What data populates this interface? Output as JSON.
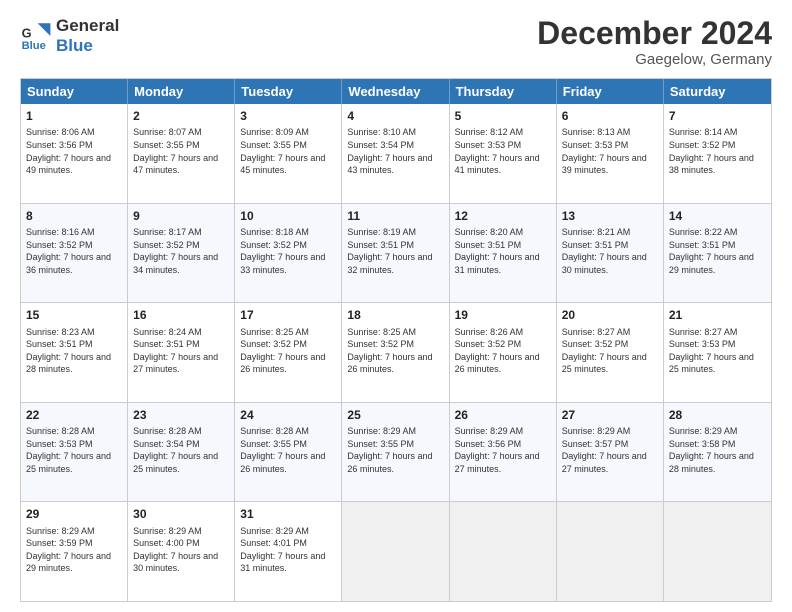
{
  "header": {
    "logo_line1": "General",
    "logo_line2": "Blue",
    "month_title": "December 2024",
    "location": "Gaegelow, Germany"
  },
  "weekdays": [
    "Sunday",
    "Monday",
    "Tuesday",
    "Wednesday",
    "Thursday",
    "Friday",
    "Saturday"
  ],
  "weeks": [
    [
      {
        "day": "1",
        "sunrise": "Sunrise: 8:06 AM",
        "sunset": "Sunset: 3:56 PM",
        "daylight": "Daylight: 7 hours and 49 minutes."
      },
      {
        "day": "2",
        "sunrise": "Sunrise: 8:07 AM",
        "sunset": "Sunset: 3:55 PM",
        "daylight": "Daylight: 7 hours and 47 minutes."
      },
      {
        "day": "3",
        "sunrise": "Sunrise: 8:09 AM",
        "sunset": "Sunset: 3:55 PM",
        "daylight": "Daylight: 7 hours and 45 minutes."
      },
      {
        "day": "4",
        "sunrise": "Sunrise: 8:10 AM",
        "sunset": "Sunset: 3:54 PM",
        "daylight": "Daylight: 7 hours and 43 minutes."
      },
      {
        "day": "5",
        "sunrise": "Sunrise: 8:12 AM",
        "sunset": "Sunset: 3:53 PM",
        "daylight": "Daylight: 7 hours and 41 minutes."
      },
      {
        "day": "6",
        "sunrise": "Sunrise: 8:13 AM",
        "sunset": "Sunset: 3:53 PM",
        "daylight": "Daylight: 7 hours and 39 minutes."
      },
      {
        "day": "7",
        "sunrise": "Sunrise: 8:14 AM",
        "sunset": "Sunset: 3:52 PM",
        "daylight": "Daylight: 7 hours and 38 minutes."
      }
    ],
    [
      {
        "day": "8",
        "sunrise": "Sunrise: 8:16 AM",
        "sunset": "Sunset: 3:52 PM",
        "daylight": "Daylight: 7 hours and 36 minutes."
      },
      {
        "day": "9",
        "sunrise": "Sunrise: 8:17 AM",
        "sunset": "Sunset: 3:52 PM",
        "daylight": "Daylight: 7 hours and 34 minutes."
      },
      {
        "day": "10",
        "sunrise": "Sunrise: 8:18 AM",
        "sunset": "Sunset: 3:52 PM",
        "daylight": "Daylight: 7 hours and 33 minutes."
      },
      {
        "day": "11",
        "sunrise": "Sunrise: 8:19 AM",
        "sunset": "Sunset: 3:51 PM",
        "daylight": "Daylight: 7 hours and 32 minutes."
      },
      {
        "day": "12",
        "sunrise": "Sunrise: 8:20 AM",
        "sunset": "Sunset: 3:51 PM",
        "daylight": "Daylight: 7 hours and 31 minutes."
      },
      {
        "day": "13",
        "sunrise": "Sunrise: 8:21 AM",
        "sunset": "Sunset: 3:51 PM",
        "daylight": "Daylight: 7 hours and 30 minutes."
      },
      {
        "day": "14",
        "sunrise": "Sunrise: 8:22 AM",
        "sunset": "Sunset: 3:51 PM",
        "daylight": "Daylight: 7 hours and 29 minutes."
      }
    ],
    [
      {
        "day": "15",
        "sunrise": "Sunrise: 8:23 AM",
        "sunset": "Sunset: 3:51 PM",
        "daylight": "Daylight: 7 hours and 28 minutes."
      },
      {
        "day": "16",
        "sunrise": "Sunrise: 8:24 AM",
        "sunset": "Sunset: 3:51 PM",
        "daylight": "Daylight: 7 hours and 27 minutes."
      },
      {
        "day": "17",
        "sunrise": "Sunrise: 8:25 AM",
        "sunset": "Sunset: 3:52 PM",
        "daylight": "Daylight: 7 hours and 26 minutes."
      },
      {
        "day": "18",
        "sunrise": "Sunrise: 8:25 AM",
        "sunset": "Sunset: 3:52 PM",
        "daylight": "Daylight: 7 hours and 26 minutes."
      },
      {
        "day": "19",
        "sunrise": "Sunrise: 8:26 AM",
        "sunset": "Sunset: 3:52 PM",
        "daylight": "Daylight: 7 hours and 26 minutes."
      },
      {
        "day": "20",
        "sunrise": "Sunrise: 8:27 AM",
        "sunset": "Sunset: 3:52 PM",
        "daylight": "Daylight: 7 hours and 25 minutes."
      },
      {
        "day": "21",
        "sunrise": "Sunrise: 8:27 AM",
        "sunset": "Sunset: 3:53 PM",
        "daylight": "Daylight: 7 hours and 25 minutes."
      }
    ],
    [
      {
        "day": "22",
        "sunrise": "Sunrise: 8:28 AM",
        "sunset": "Sunset: 3:53 PM",
        "daylight": "Daylight: 7 hours and 25 minutes."
      },
      {
        "day": "23",
        "sunrise": "Sunrise: 8:28 AM",
        "sunset": "Sunset: 3:54 PM",
        "daylight": "Daylight: 7 hours and 25 minutes."
      },
      {
        "day": "24",
        "sunrise": "Sunrise: 8:28 AM",
        "sunset": "Sunset: 3:55 PM",
        "daylight": "Daylight: 7 hours and 26 minutes."
      },
      {
        "day": "25",
        "sunrise": "Sunrise: 8:29 AM",
        "sunset": "Sunset: 3:55 PM",
        "daylight": "Daylight: 7 hours and 26 minutes."
      },
      {
        "day": "26",
        "sunrise": "Sunrise: 8:29 AM",
        "sunset": "Sunset: 3:56 PM",
        "daylight": "Daylight: 7 hours and 27 minutes."
      },
      {
        "day": "27",
        "sunrise": "Sunrise: 8:29 AM",
        "sunset": "Sunset: 3:57 PM",
        "daylight": "Daylight: 7 hours and 27 minutes."
      },
      {
        "day": "28",
        "sunrise": "Sunrise: 8:29 AM",
        "sunset": "Sunset: 3:58 PM",
        "daylight": "Daylight: 7 hours and 28 minutes."
      }
    ],
    [
      {
        "day": "29",
        "sunrise": "Sunrise: 8:29 AM",
        "sunset": "Sunset: 3:59 PM",
        "daylight": "Daylight: 7 hours and 29 minutes."
      },
      {
        "day": "30",
        "sunrise": "Sunrise: 8:29 AM",
        "sunset": "Sunset: 4:00 PM",
        "daylight": "Daylight: 7 hours and 30 minutes."
      },
      {
        "day": "31",
        "sunrise": "Sunrise: 8:29 AM",
        "sunset": "Sunset: 4:01 PM",
        "daylight": "Daylight: 7 hours and 31 minutes."
      },
      {
        "day": "",
        "sunrise": "",
        "sunset": "",
        "daylight": ""
      },
      {
        "day": "",
        "sunrise": "",
        "sunset": "",
        "daylight": ""
      },
      {
        "day": "",
        "sunrise": "",
        "sunset": "",
        "daylight": ""
      },
      {
        "day": "",
        "sunrise": "",
        "sunset": "",
        "daylight": ""
      }
    ]
  ]
}
